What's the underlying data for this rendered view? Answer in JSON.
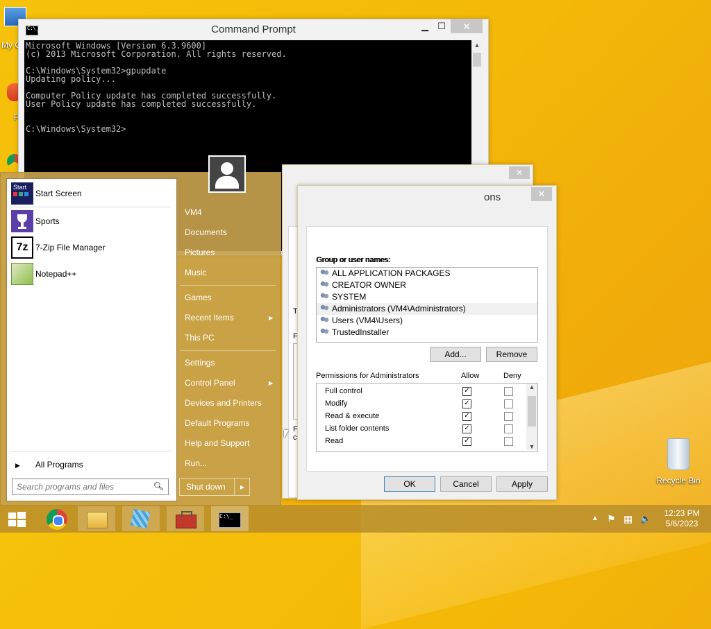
{
  "desktop": {
    "icons": [
      {
        "label": "My C",
        "name": "my-computer-icon"
      },
      {
        "label": "F",
        "name": "desktop-file-icon"
      },
      {
        "label": "Recycle Bin",
        "name": "recycle-bin-icon"
      }
    ]
  },
  "cmd": {
    "title": "Command Prompt",
    "minimize": "▁",
    "maximize": "☐",
    "close": "✕",
    "lines": [
      "Microsoft Windows [Version 6.3.9600]",
      "(c) 2013 Microsoft Corporation. All rights reserved.",
      "",
      "C:\\Windows\\System32>gpupdate",
      "Updating policy...",
      "",
      "Computer Policy update has completed successfully.",
      "User Policy update has completed successfully.",
      "",
      "",
      "C:\\Windows\\System32>"
    ]
  },
  "dialog_back": {
    "close": "✕",
    "frag_t": "T",
    "frag_f": "F",
    "frag_f2": "F",
    "frag_c": "c"
  },
  "dialog": {
    "title_fragment": "ons",
    "close": "✕",
    "group_label": "Group or user names:",
    "users": [
      {
        "name": "ALL APPLICATION PACKAGES",
        "selected": false
      },
      {
        "name": "CREATOR OWNER",
        "selected": false
      },
      {
        "name": "SYSTEM",
        "selected": false
      },
      {
        "name": "Administrators (VM4\\Administrators)",
        "selected": true
      },
      {
        "name": "Users (VM4\\Users)",
        "selected": false
      },
      {
        "name": "TrustedInstaller",
        "selected": false
      }
    ],
    "add_label": "Add...",
    "remove_label": "Remove",
    "perm_label": "Permissions for Administrators",
    "allow_label": "Allow",
    "deny_label": "Deny",
    "permissions": [
      {
        "name": "Full control",
        "allow": true,
        "deny": false
      },
      {
        "name": "Modify",
        "allow": true,
        "deny": false
      },
      {
        "name": "Read & execute",
        "allow": true,
        "deny": false
      },
      {
        "name": "List folder contents",
        "allow": true,
        "deny": false
      },
      {
        "name": "Read",
        "allow": true,
        "deny": false
      }
    ],
    "ok_label": "OK",
    "cancel_label": "Cancel",
    "apply_label": "Apply"
  },
  "start_menu": {
    "pinned": [
      {
        "label": "Start Screen",
        "icon": "start-screen-icon"
      },
      {
        "label": "Sports",
        "icon": "sports-trophy-icon"
      },
      {
        "label": "7-Zip File Manager",
        "icon": "7zip-icon"
      },
      {
        "label": "Notepad++",
        "icon": "notepad-plus-plus-icon"
      }
    ],
    "start_tile_text": "Start",
    "all_programs": "All Programs",
    "search_placeholder": "Search programs and files",
    "right_links": [
      {
        "label": "VM4",
        "arrow": false
      },
      {
        "label": "Documents",
        "arrow": false
      },
      {
        "label": "Pictures",
        "arrow": false
      },
      {
        "label": "Music",
        "arrow": false
      },
      {
        "label": "Games",
        "arrow": false
      },
      {
        "label": "Recent Items",
        "arrow": true
      },
      {
        "label": "This PC",
        "arrow": false
      },
      {
        "label": "Settings",
        "arrow": false
      },
      {
        "label": "Control Panel",
        "arrow": true
      },
      {
        "label": "Devices and Printers",
        "arrow": false
      },
      {
        "label": "Default Programs",
        "arrow": false
      },
      {
        "label": "Help and Support",
        "arrow": false
      },
      {
        "label": "Run...",
        "arrow": false
      }
    ],
    "shutdown_label": "Shut down",
    "shutdown_arrow": "▸"
  },
  "taskbar": {
    "apps": [
      "windows-start-icon",
      "chrome-icon",
      "file-explorer-icon",
      "network-app-icon",
      "toolbox-icon",
      "command-prompt-icon"
    ],
    "tray": {
      "overflow": "▲",
      "flag": "⚑",
      "network": "▦",
      "volume": "🔈"
    },
    "time": "12:23 PM",
    "date": "5/6/2023"
  }
}
